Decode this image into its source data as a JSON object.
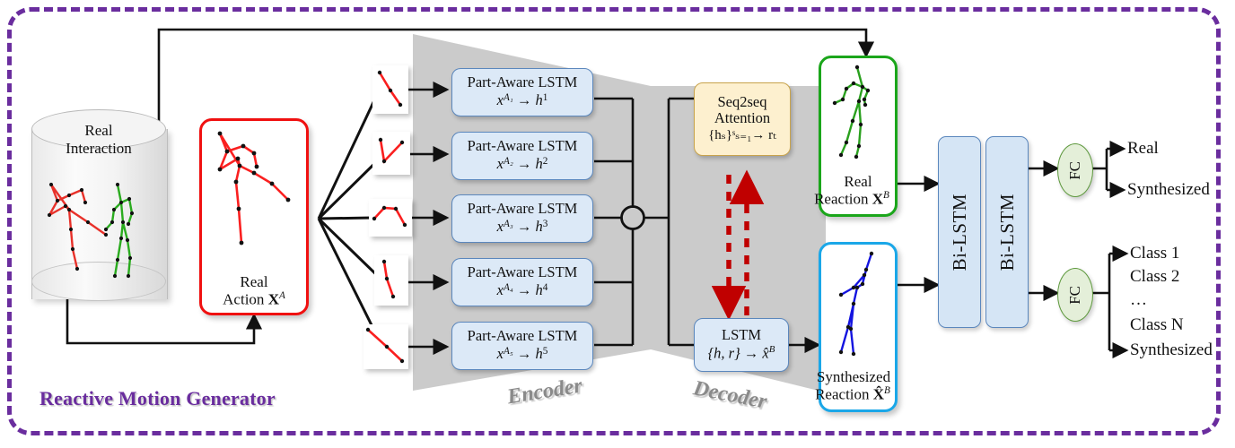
{
  "diagram": {
    "title": "Reactive Motion Generator",
    "accent_purple": "#6a2d9e",
    "encoder_label": "Encoder",
    "decoder_label": "Decoder"
  },
  "database": {
    "label_line1": "Real",
    "label_line2": "Interaction"
  },
  "input_panel": {
    "caption_line1": "Real",
    "caption_line2_prefix": "Action ",
    "caption_symbol": "X",
    "caption_superscript": "A"
  },
  "parts": [
    {
      "id": "part-1"
    },
    {
      "id": "part-2"
    },
    {
      "id": "part-3"
    },
    {
      "id": "part-4"
    },
    {
      "id": "part-5"
    }
  ],
  "encoder": {
    "modules": [
      {
        "title": "Part-Aware LSTM",
        "input": "x",
        "input_sub": "A₁",
        "output": "h",
        "output_sup": "1"
      },
      {
        "title": "Part-Aware LSTM",
        "input": "x",
        "input_sub": "A₂",
        "output": "h",
        "output_sup": "2"
      },
      {
        "title": "Part-Aware LSTM",
        "input": "x",
        "input_sub": "A₃",
        "output": "h",
        "output_sup": "3"
      },
      {
        "title": "Part-Aware LSTM",
        "input": "x",
        "input_sub": "A₄",
        "output": "h",
        "output_sup": "4"
      },
      {
        "title": "Part-Aware LSTM",
        "input": "x",
        "input_sub": "A₅",
        "output": "h",
        "output_sup": "5"
      }
    ],
    "merge_symbol": "⊕"
  },
  "decoder": {
    "attention": {
      "line1": "Seq2seq",
      "line2": "Attention",
      "formula": "{hₛ}ˢₛ₌₁→ rₜ"
    },
    "lstm": {
      "title": "LSTM",
      "formula": "{h, r} → x̂"
    }
  },
  "real_reaction": {
    "caption_line1": "Real",
    "caption_line2_prefix": "Reaction ",
    "caption_symbol": "X",
    "caption_superscript": "B"
  },
  "synth_reaction": {
    "caption_line1": "Synthesized",
    "caption_line2_prefix": "Reaction ",
    "caption_symbol": "X̂",
    "caption_superscript": "B"
  },
  "discriminator": {
    "bilstm_1": "Bi-LSTM",
    "bilstm_2": "Bi-LSTM",
    "fc_top": "FC",
    "fc_bottom": "FC",
    "outputs_top": [
      "Real",
      "Synthesized"
    ],
    "outputs_bottom": [
      "Class 1",
      "Class 2",
      "…",
      "Class N",
      "Synthesized"
    ]
  },
  "chart_data": {
    "type": "table",
    "title": "Reactive Motion Generator architecture",
    "nodes": [
      "Real Interaction database",
      "Real Action X^A",
      "5 body-part inputs",
      "Part-Aware LSTM x^{A_1..A_5} -> h^{1..5}",
      "Merge (+)",
      "Seq2seq Attention {h_s}_{s=1}^S -> r_t",
      "Decoder LSTM {h,r} -> x-hat^B",
      "Real Reaction X^B",
      "Synthesized Reaction X-hat^B",
      "Bi-LSTM x2",
      "FC (real/synth)",
      "FC (class)"
    ]
  }
}
